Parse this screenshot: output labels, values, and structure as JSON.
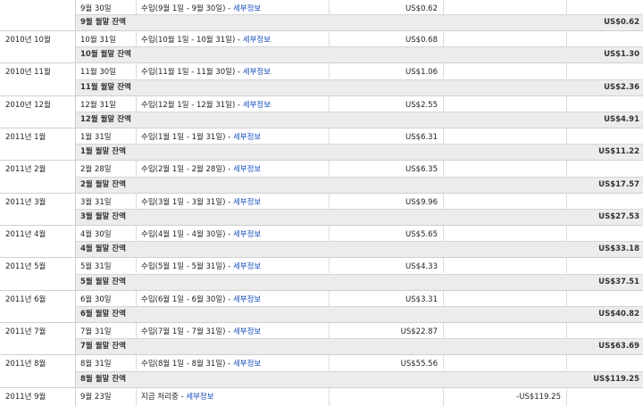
{
  "link_label": "세부정보",
  "months": [
    {
      "label": "",
      "date": "9월 30일",
      "desc": "수입(9월 1일 - 9월 30일) - ",
      "amount": "US$0.62",
      "balance_label": "9월 월말 잔액",
      "balance": "US$0.62"
    },
    {
      "label": "2010년 10월",
      "date": "10월 31일",
      "desc": "수입(10월 1일 - 10월 31일) - ",
      "amount": "US$0.68",
      "balance_label": "10월 월말 잔액",
      "balance": "US$1.30"
    },
    {
      "label": "2010년 11월",
      "date": "11월 30일",
      "desc": "수입(11월 1일 - 11월 30일) - ",
      "amount": "US$1.06",
      "balance_label": "11월 월말 잔액",
      "balance": "US$2.36"
    },
    {
      "label": "2010년 12월",
      "date": "12월 31일",
      "desc": "수입(12월 1일 - 12월 31일) - ",
      "amount": "US$2.55",
      "balance_label": "12월 월말 잔액",
      "balance": "US$4.91"
    },
    {
      "label": "2011년 1월",
      "date": "1월 31일",
      "desc": "수입(1월 1일 - 1월 31일) - ",
      "amount": "US$6.31",
      "balance_label": "1월 월말 잔액",
      "balance": "US$11.22"
    },
    {
      "label": "2011년 2월",
      "date": "2월 28일",
      "desc": "수입(2월 1일 - 2월 28일) - ",
      "amount": "US$6.35",
      "balance_label": "2월 월말 잔액",
      "balance": "US$17.57"
    },
    {
      "label": "2011년 3월",
      "date": "3월 31일",
      "desc": "수입(3월 1일 - 3월 31일) - ",
      "amount": "US$9.96",
      "balance_label": "3월 월말 잔액",
      "balance": "US$27.53"
    },
    {
      "label": "2011년 4월",
      "date": "4월 30일",
      "desc": "수입(4월 1일 - 4월 30일) - ",
      "amount": "US$5.65",
      "balance_label": "4월 월말 잔액",
      "balance": "US$33.18"
    },
    {
      "label": "2011년 5월",
      "date": "5월 31일",
      "desc": "수입(5월 1일 - 5월 31일) - ",
      "amount": "US$4.33",
      "balance_label": "5월 월말 잔액",
      "balance": "US$37.51"
    },
    {
      "label": "2011년 6월",
      "date": "6월 30일",
      "desc": "수입(6월 1일 - 6월 30일) - ",
      "amount": "US$3.31",
      "balance_label": "6월 월말 잔액",
      "balance": "US$40.82"
    },
    {
      "label": "2011년 7월",
      "date": "7월 31일",
      "desc": "수입(7월 1일 - 7월 31일) - ",
      "amount": "US$22.87",
      "balance_label": "7월 월말 잔액",
      "balance": "US$63.69"
    },
    {
      "label": "2011년 8월",
      "date": "8월 31일",
      "desc": "수입(8월 1일 - 8월 31일) - ",
      "amount": "US$55.56",
      "balance_label": "8월 월말 잔액",
      "balance": "US$119.25"
    }
  ],
  "pending": {
    "label": "2011년 9월",
    "date": "9월 23일",
    "desc": "지금 처리중 - ",
    "amount": "-US$119.25"
  }
}
